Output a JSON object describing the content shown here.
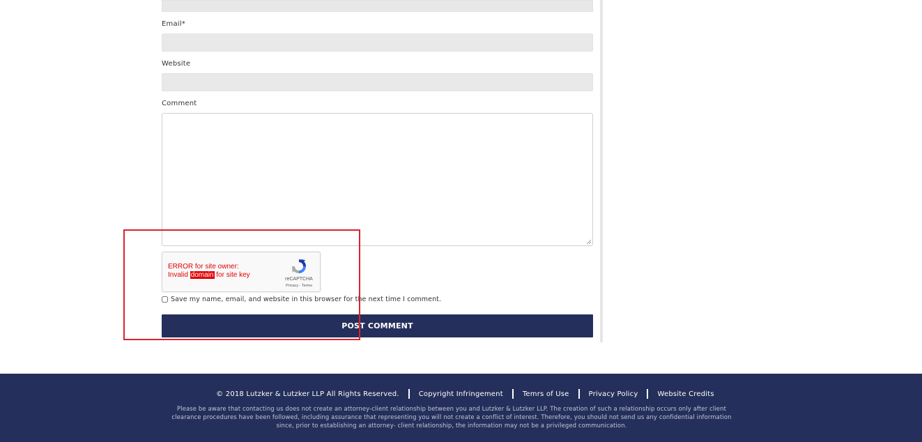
{
  "form": {
    "email_label": "Email*",
    "website_label": "Website",
    "comment_label": "Comment",
    "recaptcha": {
      "error_line1": "ERROR for site owner:",
      "error_prefix": "Invalid ",
      "error_highlight": "domain",
      "error_suffix": " for site key",
      "brand": "reCAPTCHA",
      "links": "Privacy - Terms"
    },
    "save_label": "Save my name, email, and website in this browser for the next time I comment.",
    "post_button": "POST COMMENT"
  },
  "colors": {
    "navy": "#252f5b",
    "annotation_red": "#d9232d",
    "error_red": "#e00000",
    "input_bg": "#e9e9e9"
  },
  "footer": {
    "copyright": "© 2018 Lutzker & Lutzker LLP All Rights Reserved.",
    "links": [
      "Copyright Infringement",
      "Temrs of Use",
      "Privacy Policy",
      "Website Credits"
    ],
    "disclaimer": "Please be aware that contacting us does not create an attorney-client relationship between you and Lutzker & Lutzker LLP. The creation of such a relationship occurs only after client clearance procedures have been followed, including assurance that representing you will not create a conflict of interest. Therefore, you should not send us any confidential information since, prior to establishing an attorney- client relationship, the information may not be a privileged communication."
  }
}
